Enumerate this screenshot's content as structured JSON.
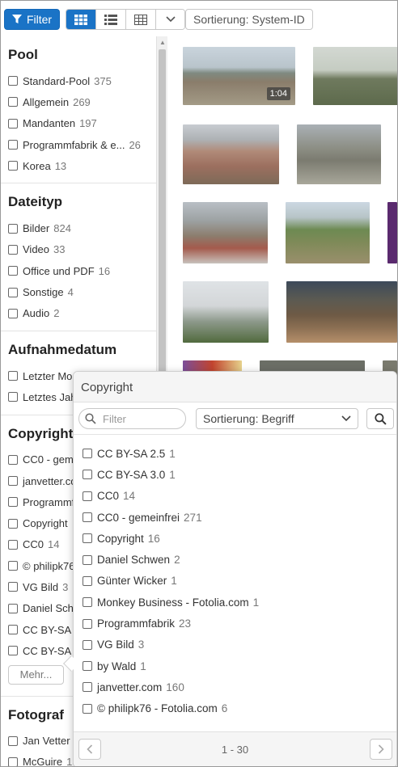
{
  "toolbar": {
    "filter_label": "Filter",
    "sort_label": "Sortierung: System-ID"
  },
  "colors": {
    "accent": "#1a73c6"
  },
  "sidebar": {
    "sections": [
      {
        "title": "Pool",
        "items": [
          {
            "label": "Standard-Pool",
            "count": "375"
          },
          {
            "label": "Allgemein",
            "count": "269"
          },
          {
            "label": "Mandanten",
            "count": "197"
          },
          {
            "label": "Programmfabrik & e...",
            "count": "26"
          },
          {
            "label": "Korea",
            "count": "13"
          }
        ]
      },
      {
        "title": "Dateityp",
        "items": [
          {
            "label": "Bilder",
            "count": "824"
          },
          {
            "label": "Video",
            "count": "33"
          },
          {
            "label": "Office und PDF",
            "count": "16"
          },
          {
            "label": "Sonstige",
            "count": "4"
          },
          {
            "label": "Audio",
            "count": "2"
          }
        ]
      },
      {
        "title": "Aufnahmedatum",
        "items": [
          {
            "label": "Letzter Mo",
            "count": ""
          },
          {
            "label": "Letztes Jah",
            "count": ""
          }
        ]
      },
      {
        "title": "Copyright",
        "items": [
          {
            "label": "CC0 - gemeinfrei",
            "count": ""
          },
          {
            "label": "janvetter.com",
            "count": ""
          },
          {
            "label": "Programmfabrik",
            "count": ""
          },
          {
            "label": "Copyright",
            "count": ""
          },
          {
            "label": "CC0",
            "count": "14"
          },
          {
            "label": "© philipk76",
            "count": ""
          },
          {
            "label": "VG Bild",
            "count": "3"
          },
          {
            "label": "Daniel Schwen",
            "count": ""
          },
          {
            "label": "CC BY-SA 2.5",
            "count": ""
          },
          {
            "label": "CC BY-SA 3.0",
            "count": ""
          }
        ],
        "more_label": "Mehr..."
      },
      {
        "title": "Fotograf",
        "items": [
          {
            "label": "Jan Vetter",
            "count": ""
          },
          {
            "label": "McGuire",
            "count": "130"
          }
        ]
      }
    ]
  },
  "thumbnails": [
    {
      "name": "beach-aerial",
      "duration": "1:04"
    },
    {
      "name": "landscape-field",
      "duration": ""
    },
    {
      "name": "city-aerial",
      "duration": ""
    },
    {
      "name": "stone-monument",
      "duration": ""
    },
    {
      "name": "snowy-building",
      "duration": ""
    },
    {
      "name": "quarry-landscape",
      "duration": ""
    },
    {
      "name": "purple-edge",
      "duration": ""
    },
    {
      "name": "office-building",
      "duration": ""
    },
    {
      "name": "lecture-hall",
      "duration": ""
    },
    {
      "name": "bottom-row",
      "duration": ""
    }
  ],
  "popup": {
    "title": "Copyright",
    "filter_placeholder": "Filter",
    "sort_label": "Sortierung: Begriff",
    "items": [
      {
        "label": "CC BY-SA 2.5",
        "count": "1"
      },
      {
        "label": "CC BY-SA 3.0",
        "count": "1"
      },
      {
        "label": "CC0",
        "count": "14"
      },
      {
        "label": "CC0 - gemeinfrei",
        "count": "271"
      },
      {
        "label": "Copyright",
        "count": "16"
      },
      {
        "label": "Daniel Schwen",
        "count": "2"
      },
      {
        "label": "Günter Wicker",
        "count": "1"
      },
      {
        "label": "Monkey Business - Fotolia.com",
        "count": "1"
      },
      {
        "label": "Programmfabrik",
        "count": "23"
      },
      {
        "label": "VG Bild",
        "count": "3"
      },
      {
        "label": "by Wald",
        "count": "1"
      },
      {
        "label": "janvetter.com",
        "count": "160"
      },
      {
        "label": "© philipk76 - Fotolia.com",
        "count": "6"
      }
    ],
    "pagination": "1 - 30"
  }
}
